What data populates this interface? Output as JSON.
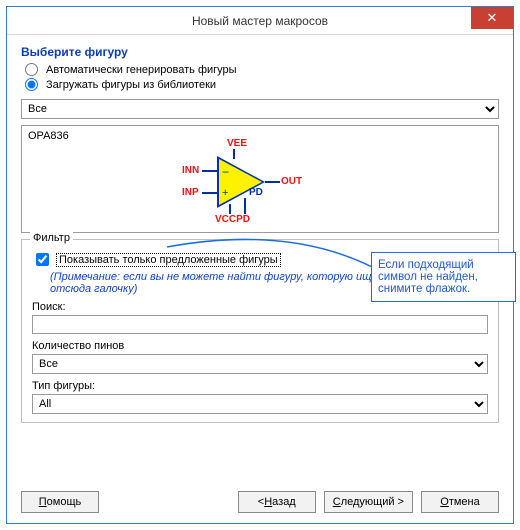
{
  "window": {
    "title": "Новый мастер макросов",
    "close": "✕"
  },
  "section_title": "Выберите фигуру",
  "radios": {
    "auto": "Автоматически генерировать фигуры",
    "lib": "Загружать фигуры из библиотеки"
  },
  "library_dropdown": {
    "value": "Все"
  },
  "preview": {
    "partname": "OPA836",
    "pins": {
      "vee": "VEE",
      "inn": "INN",
      "inp": "INP",
      "out": "OUT",
      "pd": "PD",
      "vccpd": "VCCPD"
    }
  },
  "filter": {
    "legend": "Фильтр",
    "checkbox_label": "Показывать только предложенные фигуры",
    "note": "(Примечание: если вы не можете найти фигуру, которую ищите, уберите отсюда галочку)",
    "search_label": "Поиск:",
    "search_value": "",
    "pincount_label": "Количество пинов",
    "pincount_value": "Все",
    "shapetype_label": "Тип фигуры:",
    "shapetype_value": "All"
  },
  "callout": "Если подходящий символ не найден, снимите флажок.",
  "buttons": {
    "help": "Помощь",
    "back": "< Назад",
    "next": "Следующий >",
    "cancel": "Отмена",
    "help_u": "П",
    "back_u": "Н",
    "next_u": "С",
    "cancel_u": "О"
  }
}
